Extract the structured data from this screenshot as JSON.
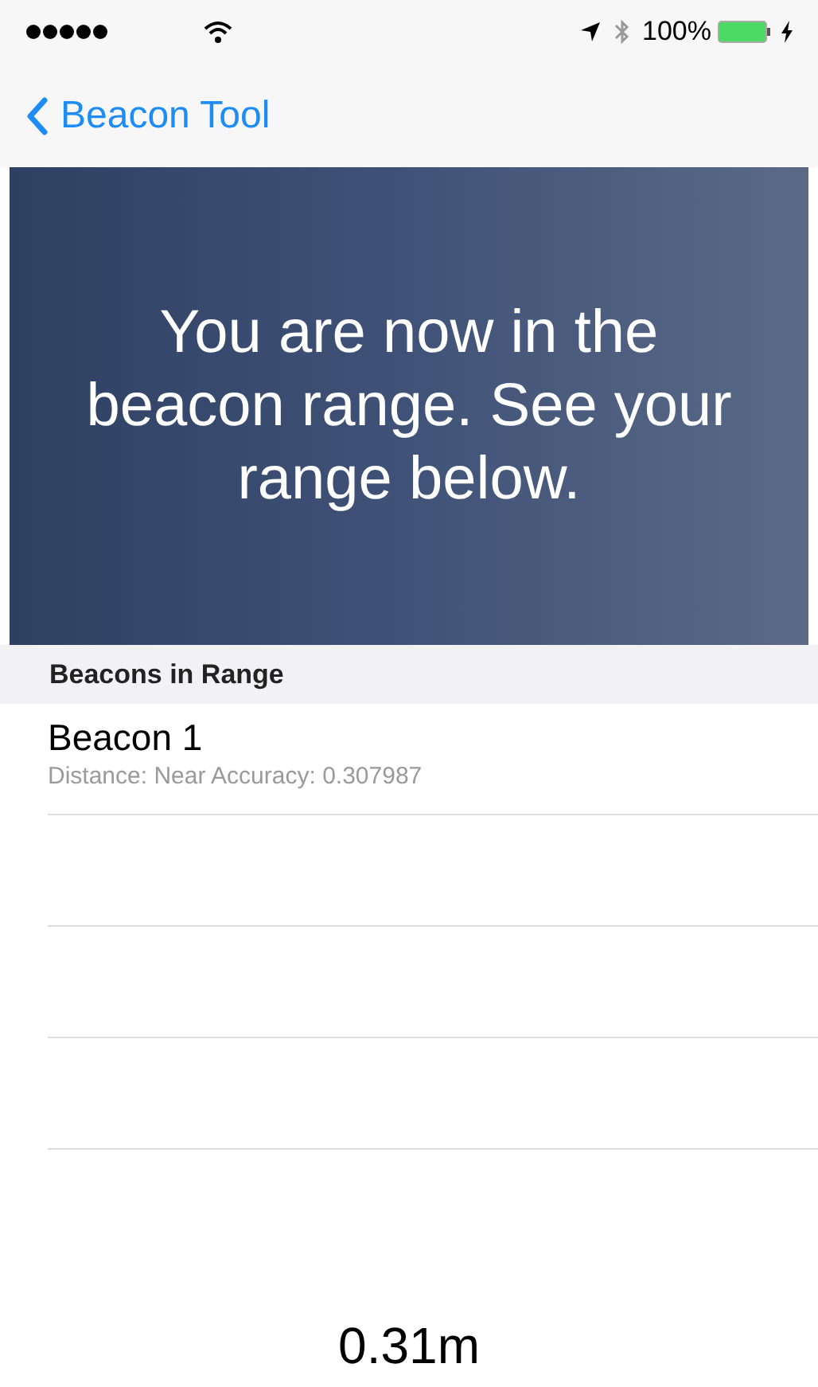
{
  "status_bar": {
    "battery": "100%",
    "charging": true
  },
  "nav": {
    "back_label": "Beacon Tool"
  },
  "banner": {
    "message": "You are now in the beacon range. See your range below."
  },
  "section": {
    "title": "Beacons in Range"
  },
  "beacons": [
    {
      "name": "Beacon 1",
      "detail": "Distance: Near Accuracy: 0.307987"
    }
  ],
  "distance": "0.31m"
}
